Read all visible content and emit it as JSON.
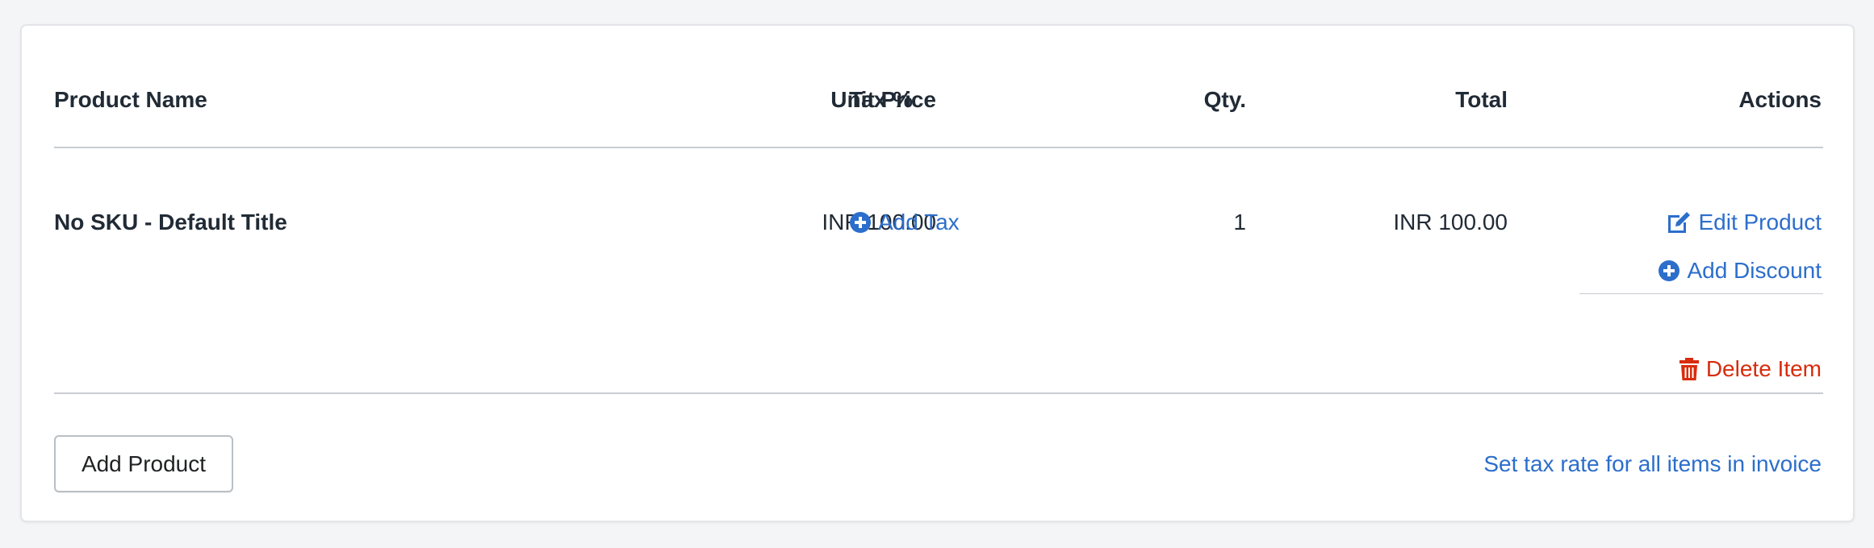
{
  "table": {
    "headers": {
      "product_name": "Product Name",
      "unit_price": "Unit Price",
      "tax": "Tax %",
      "qty": "Qty.",
      "total": "Total",
      "actions": "Actions"
    },
    "rows": [
      {
        "product_name": "No SKU - Default Title",
        "unit_price": "INR 100.00",
        "tax_action": "Add Tax",
        "qty": "1",
        "total": "INR 100.00",
        "actions": {
          "edit": "Edit Product",
          "discount": "Add Discount",
          "delete": "Delete Item"
        }
      }
    ]
  },
  "footer": {
    "add_product": "Add Product",
    "set_tax_rate": "Set tax rate for all items in invoice"
  },
  "icons": {
    "add_tax": "plus-circle-icon",
    "edit": "edit-icon",
    "discount": "plus-circle-icon",
    "delete": "trash-icon"
  },
  "colors": {
    "link": "#2c6ecb",
    "danger": "#d82c0d",
    "text": "#212b36"
  }
}
